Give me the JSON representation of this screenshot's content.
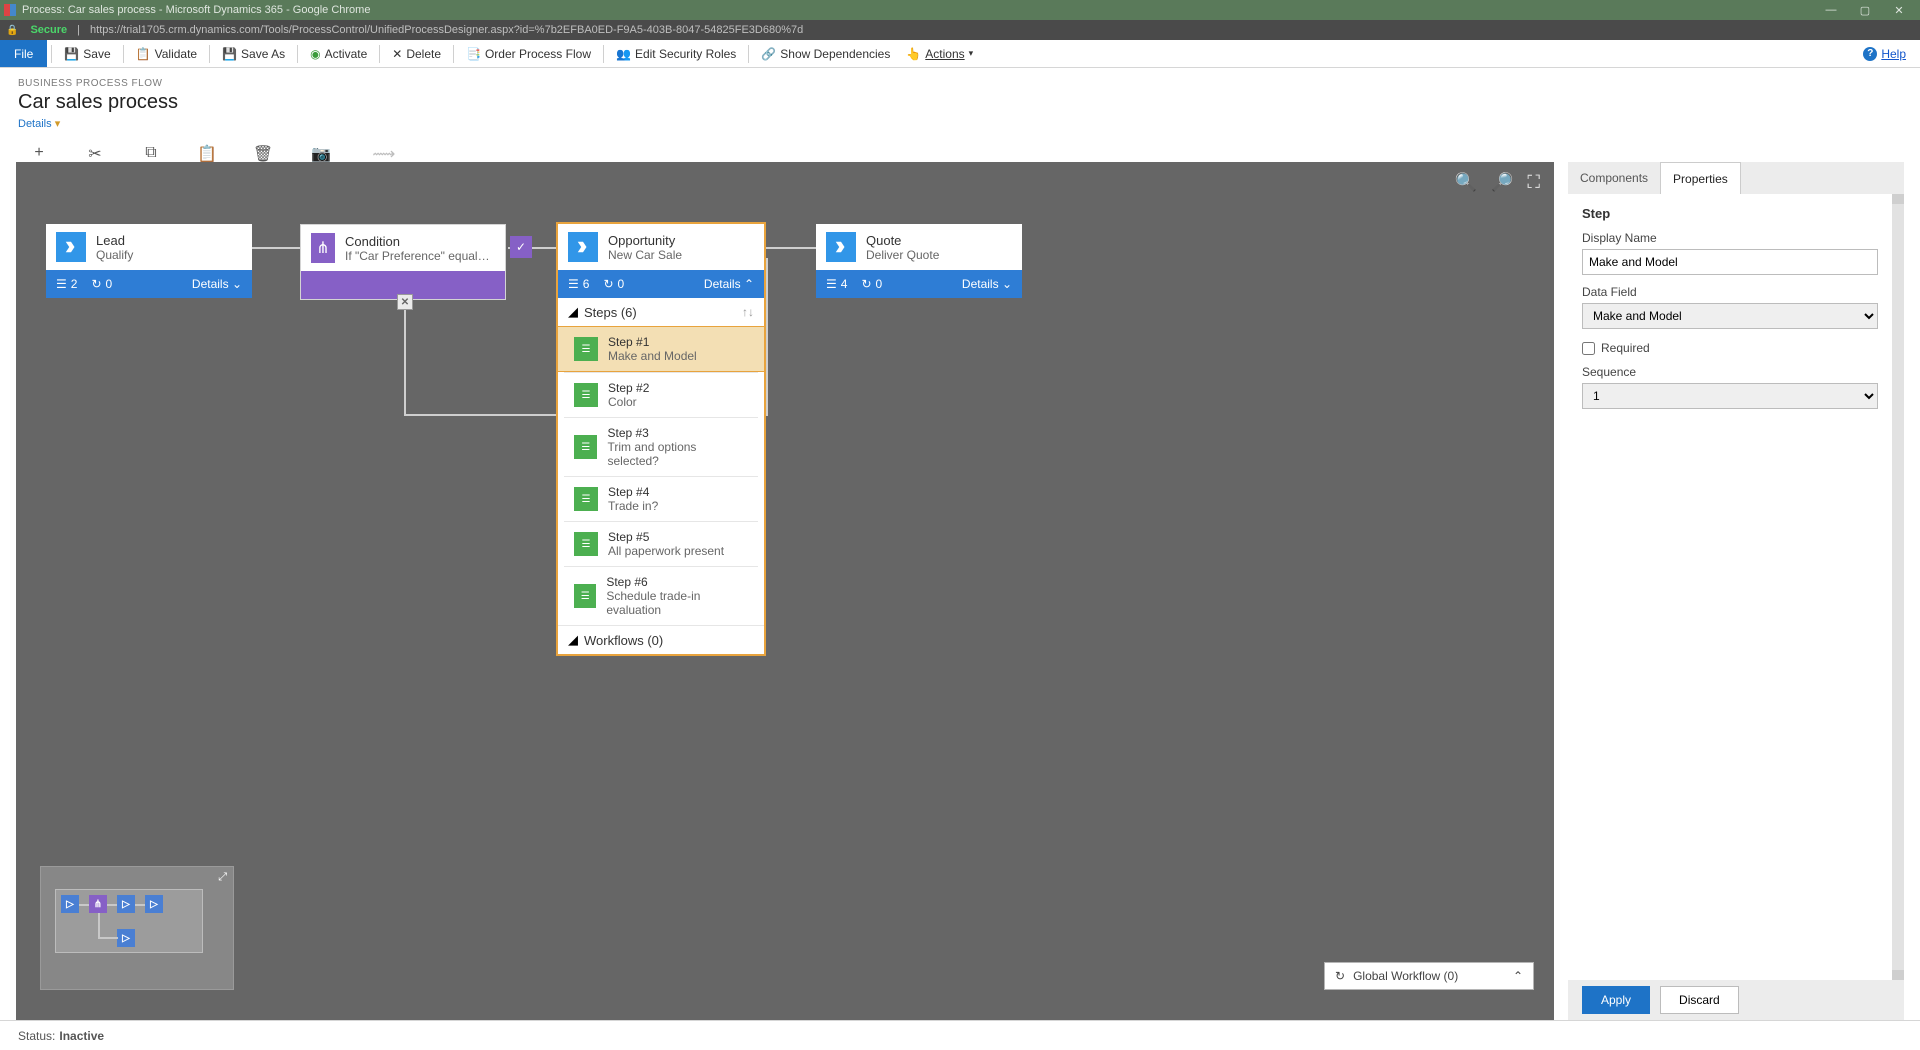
{
  "window": {
    "title": "Process: Car sales process - Microsoft Dynamics 365 - Google Chrome",
    "secure_label": "Secure",
    "url": "https://trial1705.crm.dynamics.com/Tools/ProcessControl/UnifiedProcessDesigner.aspx?id=%7b2EFBA0ED-F9A5-403B-8047-54825FE3D680%7d"
  },
  "ribbon": {
    "file": "File",
    "save": "Save",
    "validate": "Validate",
    "save_as": "Save As",
    "activate": "Activate",
    "delete": "Delete",
    "order": "Order Process Flow",
    "security": "Edit Security Roles",
    "deps": "Show Dependencies",
    "actions": "Actions",
    "help": "Help"
  },
  "header": {
    "breadcrumb": "BUSINESS PROCESS FLOW",
    "title": "Car sales process",
    "details": "Details"
  },
  "dtoolbar": {
    "add": "Add",
    "cut": "Cut",
    "copy": "Copy",
    "paste": "Paste",
    "delete": "Delete",
    "snapshot": "Snapshot",
    "connector": "Connector"
  },
  "canvas": {
    "stages": {
      "lead": {
        "title": "Lead",
        "sub": "Qualify",
        "steps": "2",
        "wf": "0",
        "details": "Details"
      },
      "condition": {
        "title": "Condition",
        "sub": "If \"Car Preference\" equals \"New ..."
      },
      "opportunity": {
        "title": "Opportunity",
        "sub": "New Car Sale",
        "steps": "6",
        "wf": "0",
        "details": "Details"
      },
      "quote": {
        "title": "Quote",
        "sub": "Deliver Quote",
        "steps": "4",
        "wf": "0",
        "details": "Details"
      }
    },
    "steps_header": "Steps (6)",
    "workflows_header": "Workflows (0)",
    "steps": [
      {
        "t": "Step #1",
        "s": "Make and Model"
      },
      {
        "t": "Step #2",
        "s": "Color"
      },
      {
        "t": "Step #3",
        "s": "Trim and options selected?"
      },
      {
        "t": "Step #4",
        "s": "Trade in?"
      },
      {
        "t": "Step #5",
        "s": "All paperwork present"
      },
      {
        "t": "Step #6",
        "s": "Schedule trade-in evaluation"
      }
    ],
    "global_wf": "Global Workflow (0)"
  },
  "panel": {
    "tab_components": "Components",
    "tab_properties": "Properties",
    "section": "Step",
    "display_name_label": "Display Name",
    "display_name_value": "Make and Model",
    "data_field_label": "Data Field",
    "data_field_value": "Make and Model",
    "required_label": "Required",
    "sequence_label": "Sequence",
    "sequence_value": "1",
    "apply": "Apply",
    "discard": "Discard"
  },
  "status": {
    "label": "Status:",
    "value": "Inactive"
  }
}
